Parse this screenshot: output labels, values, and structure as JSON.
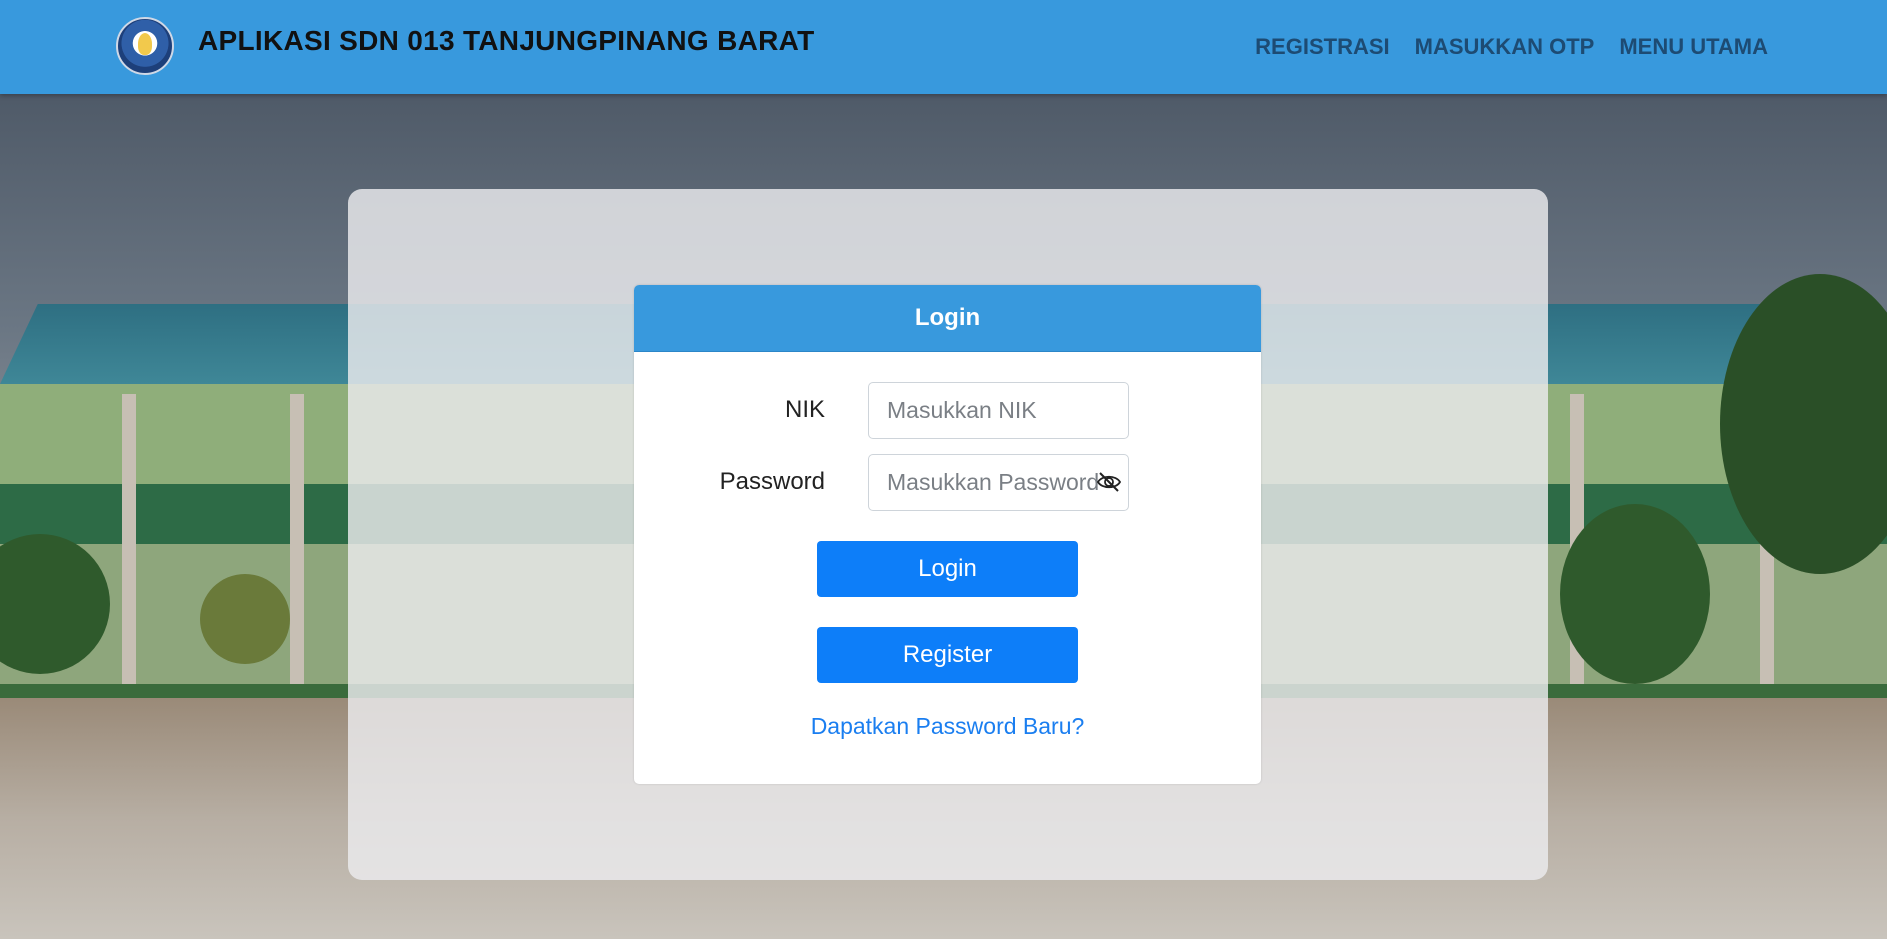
{
  "header": {
    "title": "APLIKASI SDN 013 TANJUNGPINANG BARAT",
    "logo_icon": "tut-wuri-handayani-logo",
    "nav": [
      {
        "label": "REGISTRASI"
      },
      {
        "label": "MASUKKAN OTP"
      },
      {
        "label": "MENU UTAMA"
      }
    ]
  },
  "login_card": {
    "title": "Login",
    "nik": {
      "label": "NIK",
      "placeholder": "Masukkan NIK",
      "value": ""
    },
    "password": {
      "label": "Password",
      "placeholder": "Masukkan Password",
      "value": "",
      "toggle_icon": "eye-slash-icon"
    },
    "login_button": "Login",
    "register_button": "Register",
    "forgot_link": "Dapatkan Password Baru?"
  },
  "colors": {
    "navbar": "#3899dd",
    "nav_link": "#1d4b73",
    "button": "#0d7ef9",
    "link": "#1a7ef0"
  }
}
